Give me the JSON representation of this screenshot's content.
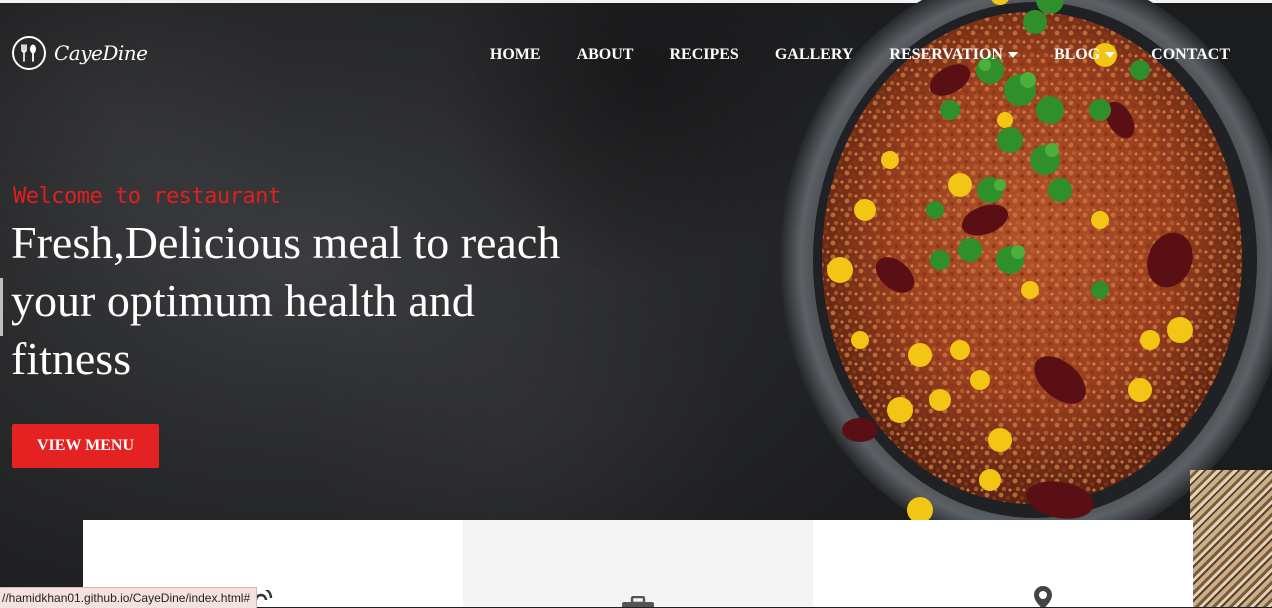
{
  "brand": {
    "name": "CayeDine",
    "icon": "fork-spoon-icon"
  },
  "nav": {
    "items": [
      {
        "label": "HOME",
        "dropdown": false
      },
      {
        "label": "ABOUT",
        "dropdown": false
      },
      {
        "label": "RECIPES",
        "dropdown": false
      },
      {
        "label": "GALLERY",
        "dropdown": false
      },
      {
        "label": "RESERVATION",
        "dropdown": true
      },
      {
        "label": "BLOG",
        "dropdown": true
      },
      {
        "label": "CONTACT",
        "dropdown": false
      }
    ]
  },
  "hero": {
    "welcome": "Welcome to restaurant",
    "headline": "Fresh,Delicious meal to reach your optimum health and fitness",
    "cta_label": "VIEW MENU"
  },
  "cards": [
    {
      "icon": "phone-icon"
    },
    {
      "icon": "clock-icon"
    },
    {
      "icon": "location-pin-icon"
    }
  ],
  "status_bar": {
    "url": "//hamidkhan01.github.io/CayeDine/index.html#"
  },
  "colors": {
    "accent": "#e42222",
    "welcome": "#e31e1e",
    "nav_text": "#ffffff"
  }
}
